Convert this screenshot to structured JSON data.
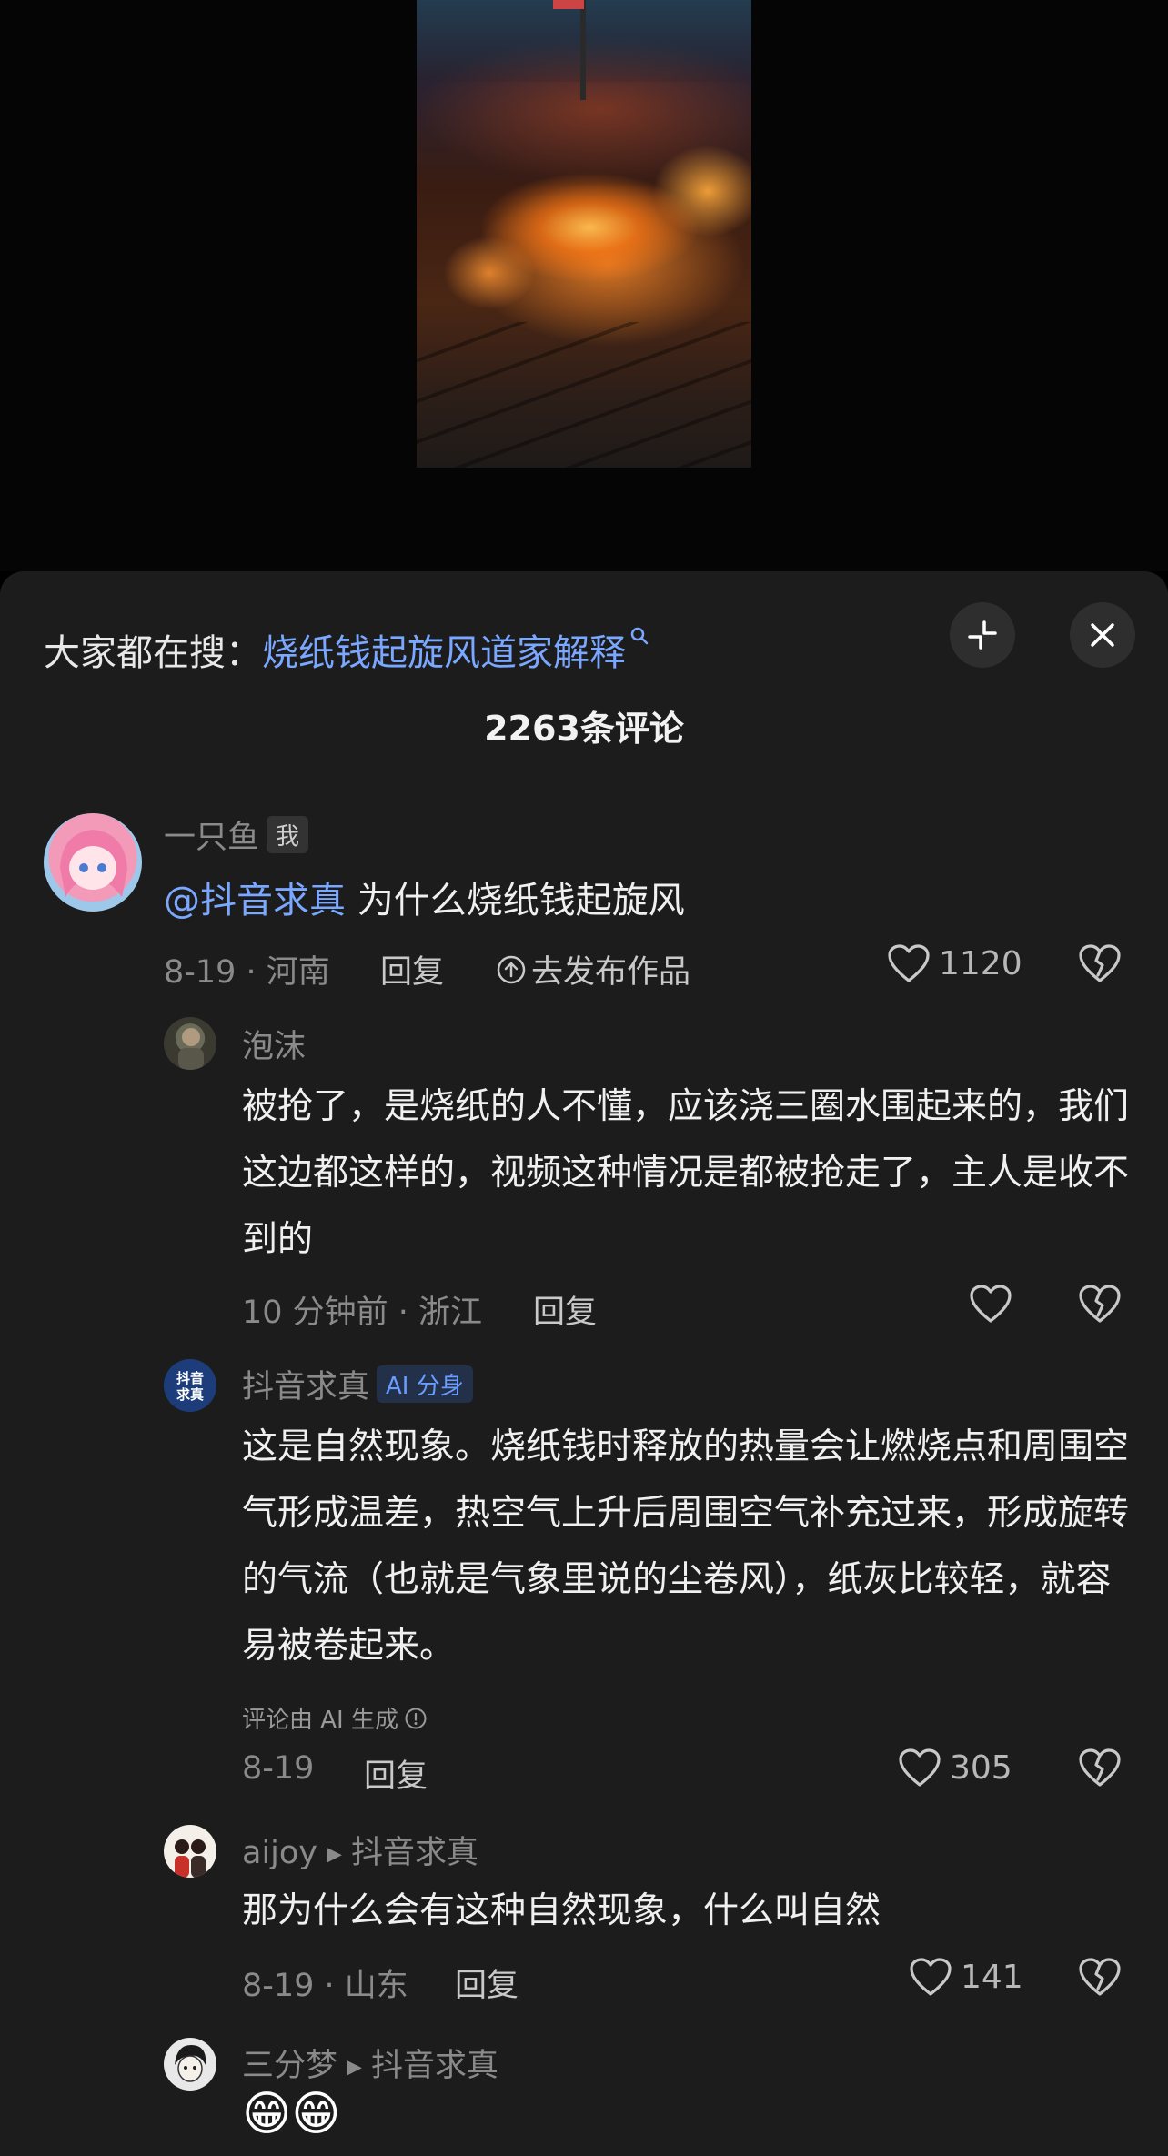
{
  "search": {
    "prefix": "大家都在搜：",
    "term": "烧纸钱起旋风道家解释"
  },
  "comment_count": "2263条评论",
  "comments": [
    {
      "user": "一只鱼",
      "badge": "我",
      "mention": "@抖音求真",
      "text": " 为什么烧纸钱起旋风",
      "meta": "8-19 · 河南",
      "reply": "回复",
      "publish": "去发布作品",
      "likes": "1120"
    }
  ],
  "replies": [
    {
      "user": "泡沫",
      "text": "被抢了，是烧纸的人不懂，应该浇三圈水围起来的，我们这边都这样的，视频这种情况是都被抢走了，主人是收不到的",
      "meta": "10 分钟前 · 浙江",
      "reply": "回复"
    },
    {
      "user": "抖音求真",
      "badge": "AI 分身",
      "text": "这是自然现象。烧纸钱时释放的热量会让燃烧点和周围空气形成温差，热空气上升后周围空气补充过来，形成旋转的气流（也就是气象里说的尘卷风），纸灰比较轻，就容易被卷起来。",
      "ai_note": "评论由 AI 生成",
      "meta": "8-19",
      "reply": "回复",
      "likes": "305"
    },
    {
      "user": "aijoy",
      "reply_to": "抖音求真",
      "text": "那为什么会有这种自然现象，什么叫自然",
      "meta": "8-19 · 山东",
      "reply": "回复",
      "likes": "141"
    },
    {
      "user": "三分梦",
      "reply_to": "抖音求真",
      "text": "😁😁"
    }
  ],
  "colors": {
    "sheet_bg": "#1c1c1c",
    "link": "#7aa7ff",
    "ai_badge": "#6a9cff"
  }
}
